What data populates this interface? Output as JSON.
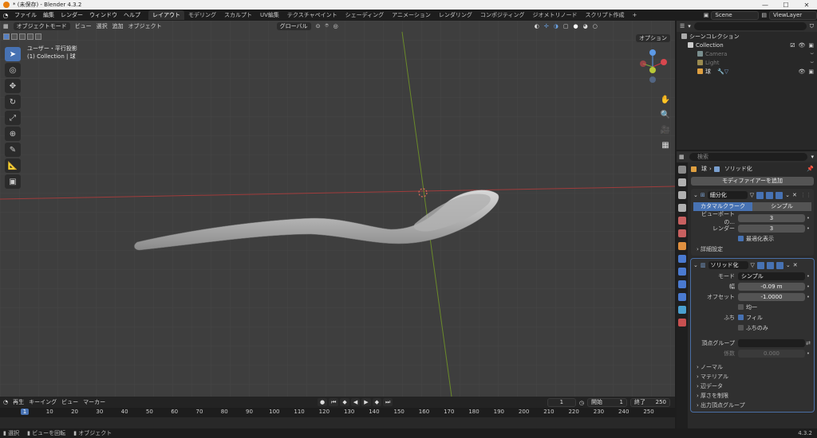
{
  "window": {
    "title": "* (未保存) - Blender 4.3.2",
    "minimize": "—",
    "maximize": "☐",
    "close": "✕"
  },
  "menu": {
    "items": [
      "ファイル",
      "編集",
      "レンダー",
      "ウィンドウ",
      "ヘルプ"
    ]
  },
  "workspaces": [
    "レイアウト",
    "モデリング",
    "スカルプト",
    "UV編集",
    "テクスチャペイント",
    "シェーディング",
    "アニメーション",
    "レンダリング",
    "コンポジティング",
    "ジオメトリノード",
    "スクリプト作成"
  ],
  "workspace_add": "+",
  "scene": {
    "name": "Scene",
    "view_layer": "ViewLayer"
  },
  "viewport": {
    "mode": "オブジェクトモード",
    "menus": [
      "ビュー",
      "選択",
      "追加",
      "オブジェクト"
    ],
    "transform": "グローバル",
    "options": "オプション",
    "info_line1": "ユーザー・平行投影",
    "info_line2": "(1) Collection | 球",
    "gizmo": {
      "x": "X",
      "y": "Y",
      "z": "Z"
    }
  },
  "timeline": {
    "menus": [
      "再生",
      "キーイング",
      "ビュー",
      "マーカー"
    ],
    "current_frame": "1",
    "start_label": "開始",
    "start": "1",
    "end_label": "終了",
    "end": "250",
    "ticks": [
      "1",
      "10",
      "20",
      "30",
      "40",
      "50",
      "60",
      "70",
      "80",
      "90",
      "100",
      "110",
      "120",
      "130",
      "140",
      "150",
      "160",
      "170",
      "180",
      "190",
      "200",
      "210",
      "220",
      "230",
      "240",
      "250"
    ]
  },
  "status": {
    "select": "選択",
    "rotate": "ビューを回転",
    "object": "オブジェクト",
    "version": "4.3.2"
  },
  "outliner": {
    "scene_collection": "シーンコレクション",
    "collection": "Collection",
    "items": [
      {
        "name": "Camera",
        "dim": true,
        "color": "#7a8f8f"
      },
      {
        "name": "Light",
        "dim": true,
        "color": "#9a8a50"
      },
      {
        "name": "球",
        "dim": false,
        "color": "#e0a040"
      }
    ]
  },
  "properties": {
    "search_placeholder": "検索",
    "breadcrumb_object": "球",
    "breadcrumb_modifier": "ソリッド化",
    "add_modifier": "モディファイアーを追加",
    "subsurf": {
      "name": "細分化",
      "type_catmull": "カタマルクラーク",
      "type_simple": "シンプル",
      "viewport_label": "ビューポートの...",
      "viewport_value": "3",
      "render_label": "レンダー",
      "render_value": "3",
      "optimal_label": "最適化表示",
      "advanced": "詳細設定"
    },
    "solidify": {
      "name": "ソリッド化",
      "mode_label": "モード",
      "mode_value": "シンプル",
      "thickness_label": "幅",
      "thickness_value": "-0.09 m",
      "offset_label": "オフセット",
      "offset_value": "-1.0000",
      "even_label": "均一",
      "rim_label": "ふち",
      "fill_label": "フィル",
      "rim_only_label": "ふちのみ",
      "vgroup_label": "頂点グループ",
      "factor_label": "係数",
      "factor_value": "0.000",
      "sections": [
        "ノーマル",
        "マテリアル",
        "辺データ",
        "厚さを制限",
        "出力頂点グループ"
      ]
    }
  }
}
